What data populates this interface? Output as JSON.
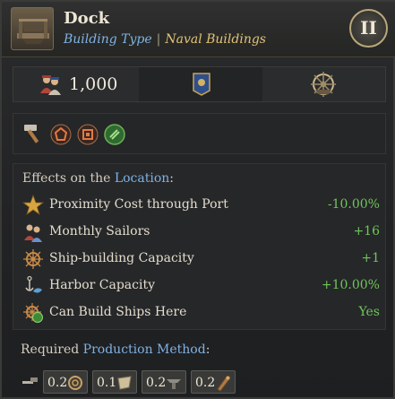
{
  "header": {
    "title": "Dock",
    "type_label": "Building Type",
    "separator": "|",
    "category": "Naval Buildings",
    "rank": "II"
  },
  "cost": {
    "sailors_icon": "sailors-icon",
    "value": "1,000",
    "banner_icon": "banner-icon",
    "ship_icon": "ship-wheel-icon"
  },
  "tags": [
    "hammer-icon",
    "pentagon-icon",
    "square-icon",
    "green-badge-icon"
  ],
  "effects": {
    "heading_prefix": "Effects on the ",
    "heading_link": "Location",
    "heading_suffix": ":",
    "rows": [
      {
        "icon": "star-icon",
        "label": "Proximity Cost through Port",
        "value": "-10.00%"
      },
      {
        "icon": "sailors-icon",
        "label": "Monthly Sailors",
        "value": "+16"
      },
      {
        "icon": "ship-wheel-icon",
        "label": "Ship-building Capacity",
        "value": "+1"
      },
      {
        "icon": "anchor-icon",
        "label": "Harbor Capacity",
        "value": "+10.00%"
      },
      {
        "icon": "ship-wheel-green-icon",
        "label": "Can Build Ships Here",
        "value": "Yes"
      }
    ]
  },
  "production": {
    "heading_prefix": "Required ",
    "heading_link": "Production Method",
    "heading_suffix": ":",
    "method_icon": "tools-icon",
    "inputs": [
      {
        "value": "0.2",
        "icon": "rope-icon"
      },
      {
        "value": "0.1",
        "icon": "cloth-icon"
      },
      {
        "value": "0.2",
        "icon": "anchor-iron-icon"
      },
      {
        "value": "0.2",
        "icon": "wood-icon"
      }
    ]
  },
  "colors": {
    "accent_blue": "#7fb2e4",
    "accent_gold": "#e2c277",
    "positive_green": "#6fc55a"
  }
}
